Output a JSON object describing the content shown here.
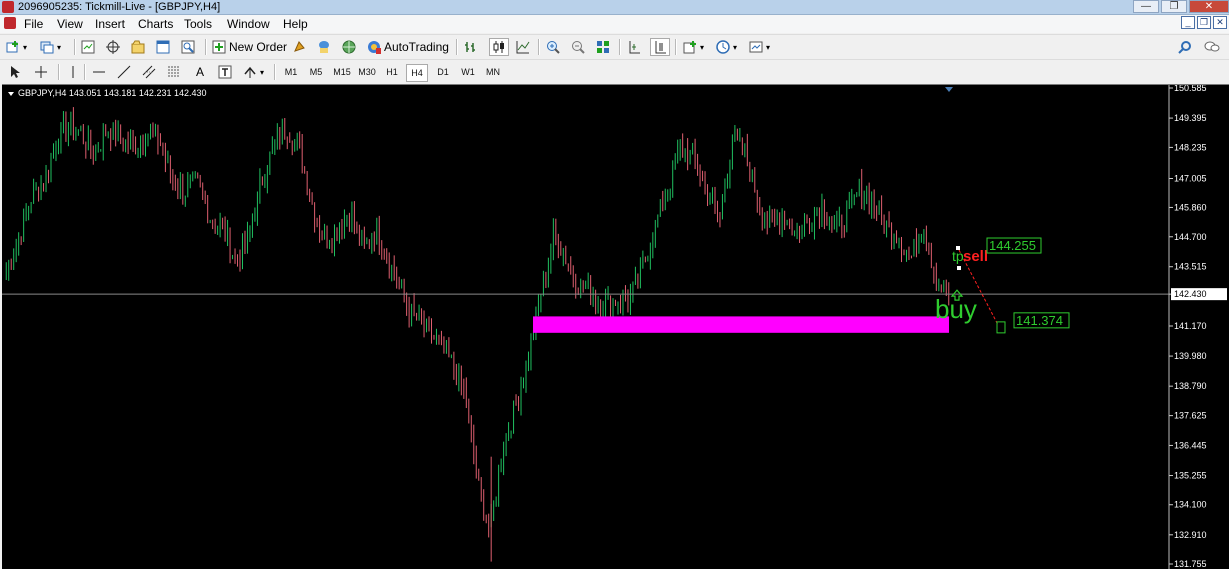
{
  "window": {
    "title": "2096905235: Tickmill-Live - [GBPJPY,H4]"
  },
  "menu": [
    "File",
    "View",
    "Insert",
    "Charts",
    "Tools",
    "Window",
    "Help"
  ],
  "toolbar1": {
    "new_order": "New Order",
    "autotrading": "AutoTrading"
  },
  "timeframes": [
    "M1",
    "M5",
    "M15",
    "M30",
    "H1",
    "H4",
    "D1",
    "W1",
    "MN"
  ],
  "active_timeframe": "H4",
  "chart": {
    "header": "GBPJPY,H4  143.051 143.181 142.231 142.430",
    "current_price": "142.430",
    "price_scale": [
      "150.585",
      "149.395",
      "148.235",
      "147.005",
      "145.860",
      "144.700",
      "143.515",
      "142.430",
      "141.170",
      "139.980",
      "138.790",
      "137.625",
      "136.445",
      "135.255",
      "134.100",
      "132.910",
      "131.755"
    ],
    "annotations": {
      "sell_label": "sell",
      "buy_label": "buy",
      "tp_label": "tp",
      "sell_price": "144.255",
      "tp_price": "141.374"
    },
    "colors": {
      "bull": "#20c060",
      "bear": "#e06070",
      "zone": "#ff00ff",
      "buy": "#2fcc2f",
      "sell": "#ff2020",
      "price_box": "#2fcc2f"
    }
  },
  "chart_data": {
    "type": "candlestick",
    "symbol": "GBPJPY",
    "timeframe": "H4",
    "ylim": [
      131.755,
      150.585
    ],
    "closes": [
      143.3,
      144.7,
      146.3,
      147.0,
      148.5,
      149.2,
      148.7,
      148.0,
      149.0,
      148.6,
      148.2,
      148.8,
      148.5,
      147.0,
      146.5,
      146.8,
      145.5,
      145.0,
      143.8,
      144.6,
      146.8,
      148.3,
      149.0,
      148.2,
      146.0,
      144.5,
      145.0,
      145.8,
      144.2,
      144.9,
      143.8,
      142.5,
      141.5,
      141.0,
      140.4,
      139.7,
      138.5,
      135.0,
      133.0,
      136.5,
      138.0,
      140.0,
      142.5,
      144.8,
      143.8,
      142.8,
      142.4,
      142.0,
      142.2,
      142.3,
      143.5,
      145.2,
      146.7,
      148.3,
      147.7,
      146.5,
      145.3,
      148.6,
      148.0,
      146.2,
      145.0,
      145.6,
      144.8,
      145.3,
      145.9,
      145.0,
      145.5,
      146.6,
      146.1,
      145.2,
      144.8,
      143.8,
      145.3,
      143.0,
      142.4
    ]
  }
}
